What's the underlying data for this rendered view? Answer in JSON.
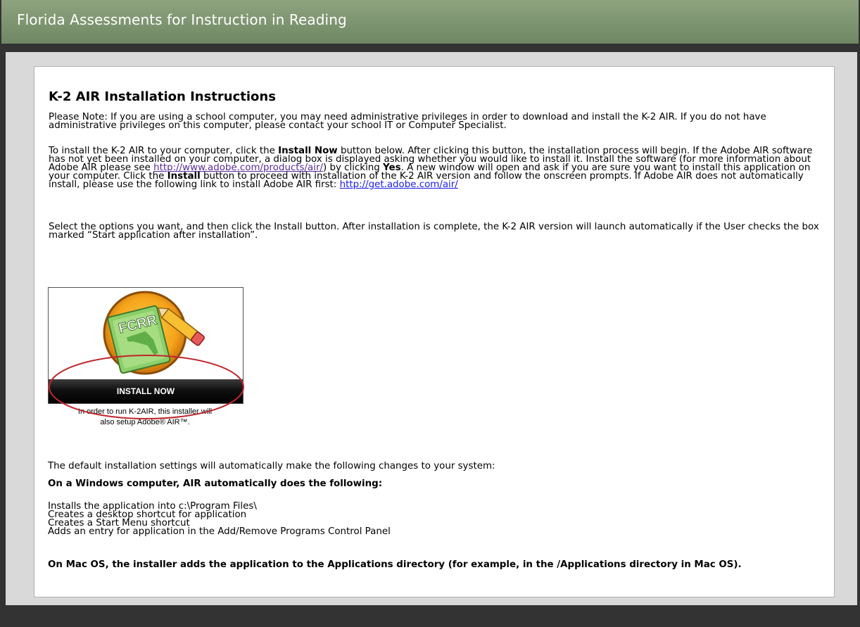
{
  "header": {
    "title": "Florida Assessments for Instruction in Reading"
  },
  "page": {
    "heading": "K-2 AIR Installation Instructions",
    "note": "Please Note: If you are using a school computer, you may need administrative privileges in order to download and install the K-2 AIR. If you do not have administrative privileges on this computer, please contact your school IT or Computer Specialist.",
    "instr": {
      "t1": "To install the K-2 AIR to your computer, click the ",
      "b1": "Install Now",
      "t2": " button below. After clicking this button, the installation process will begin. If the Adobe AIR software has not yet been installed on your computer, a dialog box is displayed asking whether you would like to install it. Install the software (for more information about Adobe AIR please see ",
      "link1": "http://www.adobe.com/products/air/",
      "t3": ") by clicking ",
      "b2": "Yes",
      "t4": ". A new window will open and ask if you are sure you want to install this application on your computer. Click the ",
      "b3": "Install",
      "t5": " button to proceed with installation of the K-2 AIR version and follow the onscreen prompts. If Adobe AIR does not automatically install, please use the following link to install Adobe AIR first: ",
      "link2": "http://get.adobe.com/air/"
    },
    "select_text": "Select the options you want, and then click the Install button. After installation is complete, the K-2 AIR version will launch automatically if the User checks the box marked “Start application after installation”.",
    "badge": {
      "logo_text": "FCRR",
      "button_label": "INSTALL NOW",
      "note_line1": "In order to run K-2AIR, this installer will",
      "note_line2": "also setup Adobe® AIR™."
    },
    "defaults_intro": "The default installation settings will automatically make the following changes to your system:",
    "windows_heading": "On a Windows computer, AIR automatically does the following:",
    "windows_items": [
      "Installs the application into c:\\Program Files\\",
      "Creates a desktop shortcut for application",
      "Creates a Start Menu shortcut",
      "Adds an entry for application in the Add/Remove Programs Control Panel"
    ],
    "mac_text": "On Mac OS, the installer adds the application to the Applications directory (for example, in the /Applications directory in Mac OS)."
  },
  "colors": {
    "header_green": "#7d9470",
    "highlight_red": "#c0272d",
    "link_blue": "#1a1aee",
    "link_visited": "#5a2a9a"
  }
}
